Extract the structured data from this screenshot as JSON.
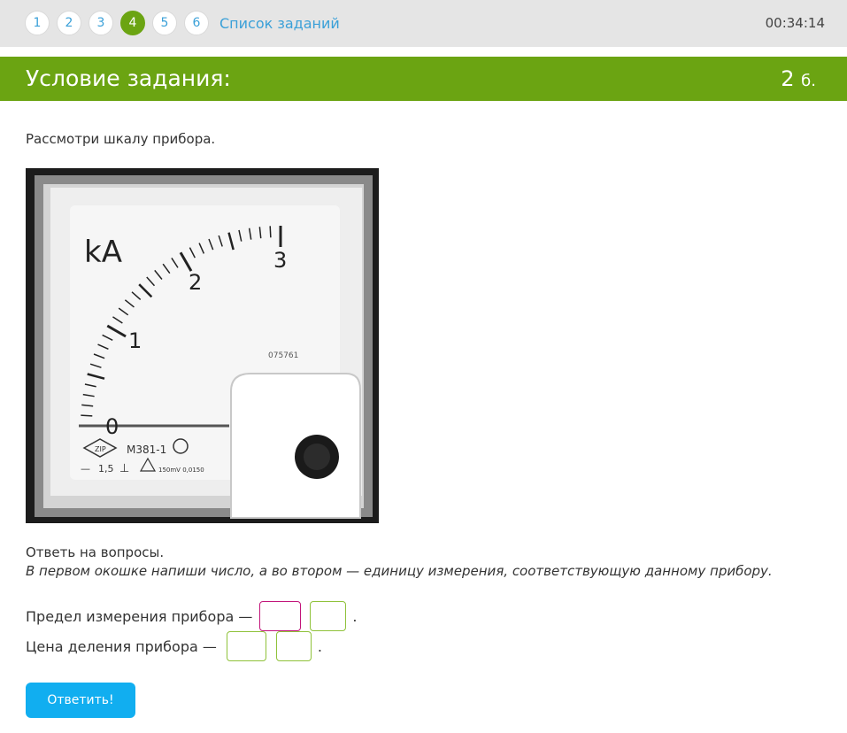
{
  "nav": {
    "pages": [
      "1",
      "2",
      "3",
      "4",
      "5",
      "6"
    ],
    "active_index": 3,
    "task_list_label": "Список заданий",
    "timer": "00:34:14"
  },
  "header": {
    "title": "Условие задания:",
    "points_value": "2",
    "points_unit": "б."
  },
  "task": {
    "intro": "Рассмотри шкалу прибора.",
    "questions_label": "Ответь на вопросы.",
    "instruction": "В первом окошке напиши число, а во втором — единицу измерения, соответствующую данному прибору.",
    "q1_label": "Предел измерения прибора —",
    "q2_label": "Цена деления прибора —",
    "q1_number": "",
    "q1_unit": "",
    "q2_number": "",
    "q2_unit": "",
    "end_punct": "."
  },
  "meter": {
    "unit_label": "kA",
    "scale_labels": [
      "0",
      "1",
      "2",
      "3"
    ],
    "serial": "075761",
    "model": "М381-1",
    "class_label": "1,5",
    "small_text": "150mV 0,0150"
  },
  "submit_label": "Ответить!"
}
